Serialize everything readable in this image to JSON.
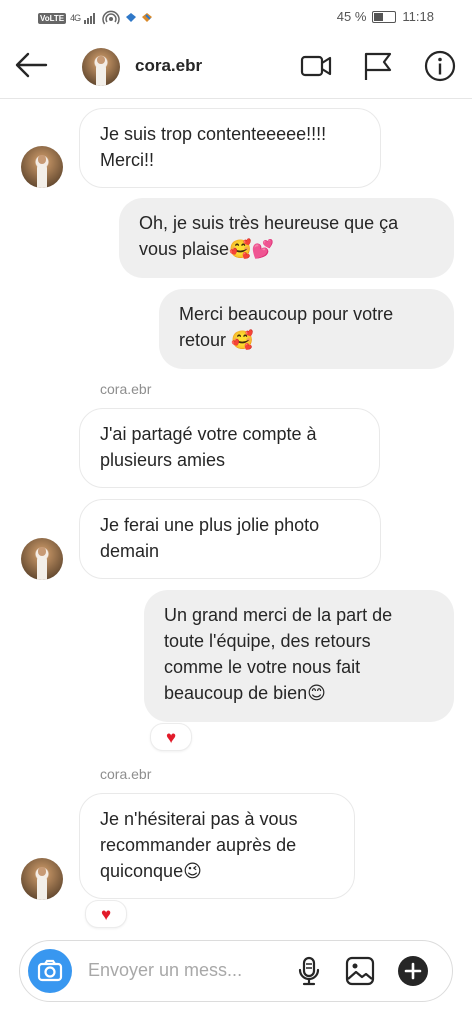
{
  "statusbar": {
    "network": "VoLTE",
    "signal": "4G",
    "battery": "45 %",
    "battery_level": 0.45,
    "time": "11:18"
  },
  "header": {
    "username": "cora.ebr"
  },
  "messages": {
    "m1": {
      "text1": "Je suis trop contenteeeee!!!!",
      "text2": "Merci!!"
    },
    "m2": {
      "text1": "Oh, je suis très heureuse que ça",
      "text2": "vous plaise",
      "emoji": "🥰💕"
    },
    "m3": {
      "text1": "Merci beaucoup pour votre",
      "text2": "retour ",
      "emoji": "🥰"
    },
    "sender1": "cora.ebr",
    "m4": {
      "text1": "J'ai partagé votre compte à",
      "text2": "plusieurs amies"
    },
    "m5": {
      "text1": "Je ferai une plus jolie photo",
      "text2": "demain"
    },
    "m6": {
      "text1": "Un grand merci de la part de",
      "text2": "toute l'équipe, des retours",
      "text3": "comme le votre nous fait",
      "text4": "beaucoup de bien",
      "emoji": "😊"
    },
    "sender2": "cora.ebr",
    "m7": {
      "text1": "Je n'hésiterai pas à vous",
      "text2": "recommander auprès de",
      "text3": "quiconque",
      "emoji": "😉"
    }
  },
  "reactions": {
    "heart": "♥"
  },
  "composer": {
    "placeholder": "Envoyer un mess..."
  },
  "colors": {
    "accent": "#3897f0",
    "heart": "#e21b2a",
    "sent_bubble": "#efefef"
  }
}
